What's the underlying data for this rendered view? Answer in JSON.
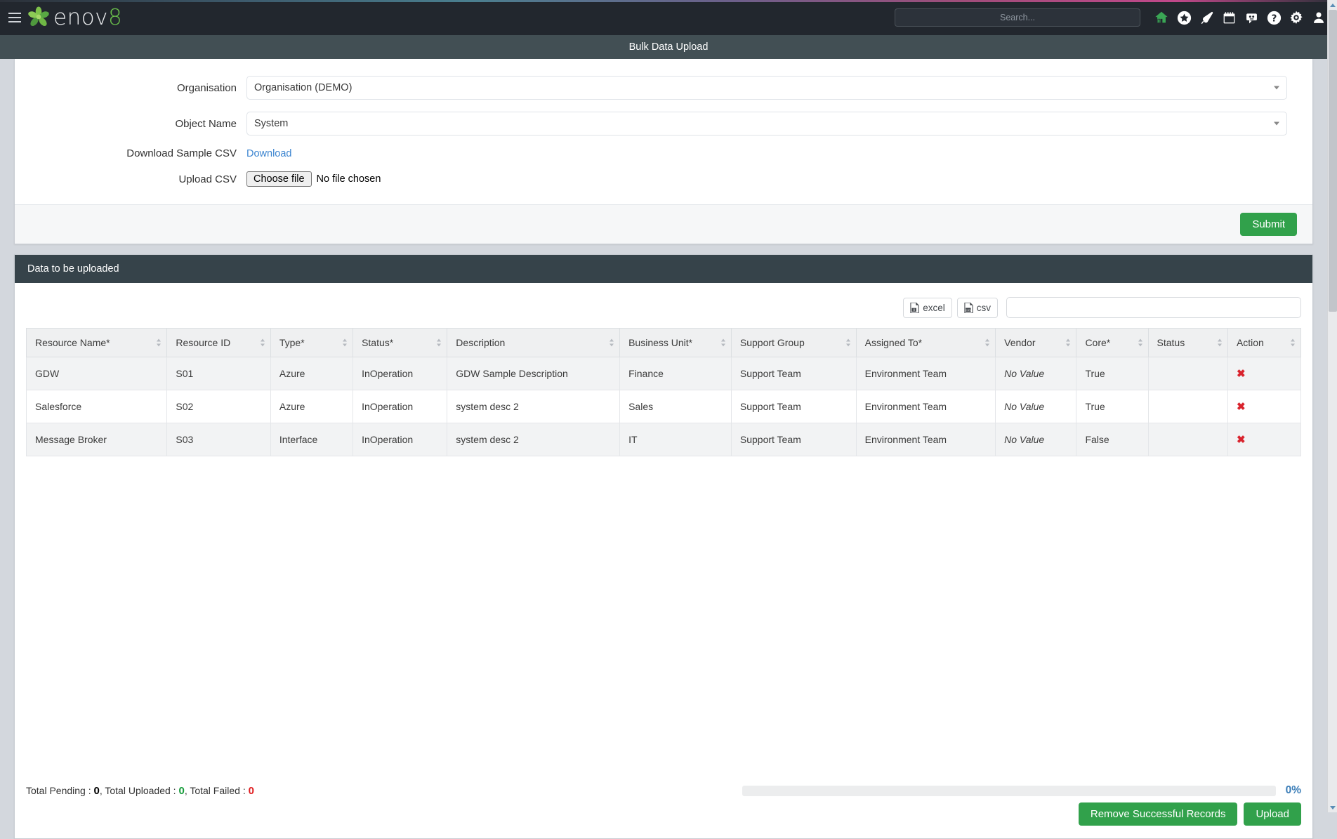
{
  "topnav": {
    "menu_icon": "hamburger-icon",
    "brand": "enov",
    "brand_accent": "8",
    "search_placeholder": "Search...",
    "icons": [
      {
        "name": "home-icon",
        "label": "Home",
        "color": "#3aa655"
      },
      {
        "name": "favorites-star-icon",
        "label": "Favorites",
        "color": "#ffffff"
      },
      {
        "name": "notification-bell-icon",
        "label": "Notifications",
        "color": "#ffffff"
      },
      {
        "name": "calendar-icon",
        "label": "Calendar",
        "color": "#ffffff"
      },
      {
        "name": "bot-assistant-icon",
        "label": "Assistant",
        "color": "#ffffff"
      },
      {
        "name": "help-question-icon",
        "label": "Help",
        "color": "#ffffff"
      },
      {
        "name": "settings-gear-icon",
        "label": "Settings",
        "color": "#ffffff"
      },
      {
        "name": "user-profile-icon",
        "label": "Profile",
        "color": "#ffffff"
      }
    ]
  },
  "page": {
    "title": "Bulk Data Upload"
  },
  "form": {
    "organisation_label": "Organisation",
    "organisation_value": "Organisation (DEMO)",
    "object_name_label": "Object Name",
    "object_name_value": "System",
    "download_sample_label": "Download Sample CSV",
    "download_link_text": "Download",
    "upload_csv_label": "Upload CSV",
    "choose_file_button": "Choose file",
    "file_status": "No file chosen",
    "submit_label": "Submit"
  },
  "data_section": {
    "header": "Data to be uploaded",
    "excel_button": "excel",
    "csv_button": "csv",
    "search_value": "",
    "search_placeholder": "",
    "columns": [
      "Resource Name*",
      "Resource ID",
      "Type*",
      "Status*",
      "Description",
      "Business Unit*",
      "Support Group",
      "Assigned To*",
      "Vendor",
      "Core*",
      "Status",
      "Action"
    ],
    "rows": [
      {
        "resource_name": "GDW",
        "resource_id": "S01",
        "type": "Azure",
        "status_req": "InOperation",
        "description": "GDW Sample Description",
        "business_unit": "Finance",
        "support_group": "Support Team",
        "assigned_to": "Environment Team",
        "vendor": "No Value",
        "core": "True",
        "status": "",
        "action": "✖"
      },
      {
        "resource_name": "Salesforce",
        "resource_id": "S02",
        "type": "Azure",
        "status_req": "InOperation",
        "description": "system desc 2",
        "business_unit": "Sales",
        "support_group": "Support Team",
        "assigned_to": "Environment Team",
        "vendor": "No Value",
        "core": "True",
        "status": "",
        "action": "✖"
      },
      {
        "resource_name": "Message Broker",
        "resource_id": "S03",
        "type": "Interface",
        "status_req": "InOperation",
        "description": "system desc 2",
        "business_unit": "IT",
        "support_group": "Support Team",
        "assigned_to": "Environment Team",
        "vendor": "No Value",
        "core": "False",
        "status": "",
        "action": "✖"
      }
    ]
  },
  "footer": {
    "total_pending_label": "Total Pending : ",
    "total_pending_value": "0",
    "total_uploaded_label": ", Total Uploaded : ",
    "total_uploaded_value": "0",
    "total_failed_label": ", Total Failed : ",
    "total_failed_value": "0",
    "progress_percent": "0%",
    "progress_value": 0,
    "remove_successful_label": "Remove Successful Records",
    "upload_label": "Upload"
  },
  "colors": {
    "accent_green": "#31a14b",
    "brand_green": "#6abf4b",
    "link_blue": "#3c85d0",
    "danger_red": "#d9232d",
    "novalue_red": "#e05c68",
    "progress_blue": "#3c7eb8",
    "nav_dark": "#22272e",
    "titlebar": "#424f54",
    "panel_header": "#36434a"
  }
}
